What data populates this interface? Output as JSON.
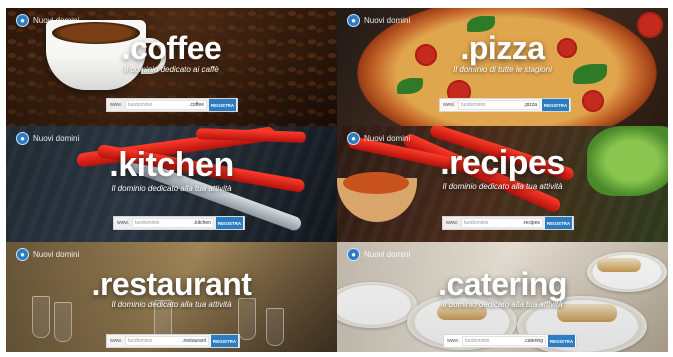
{
  "brand_label": "Nuovi domini",
  "search": {
    "www": "www.",
    "placeholder": "tuodominio",
    "button": "REGISTRA"
  },
  "tiles": [
    {
      "tld": ".coffee",
      "subtitle": "Il dominio dedicato ai caffè"
    },
    {
      "tld": ".pizza",
      "subtitle": "Il dominio di tutte le stagioni"
    },
    {
      "tld": ".kitchen",
      "subtitle": "Il dominio dedicato alla tua attività"
    },
    {
      "tld": ".recipes",
      "subtitle": "Il dominio dedicato alla tua attività"
    },
    {
      "tld": ".restaurant",
      "subtitle": "Il dominio dedicato alla tua attività"
    },
    {
      "tld": ".catering",
      "subtitle": "Il dominio dedicato alla tua attività"
    }
  ],
  "colors": {
    "accent": "#2b7cc1",
    "text": "#ffffff"
  },
  "icons": {
    "logo": "nuovi-domini-logo-icon"
  }
}
